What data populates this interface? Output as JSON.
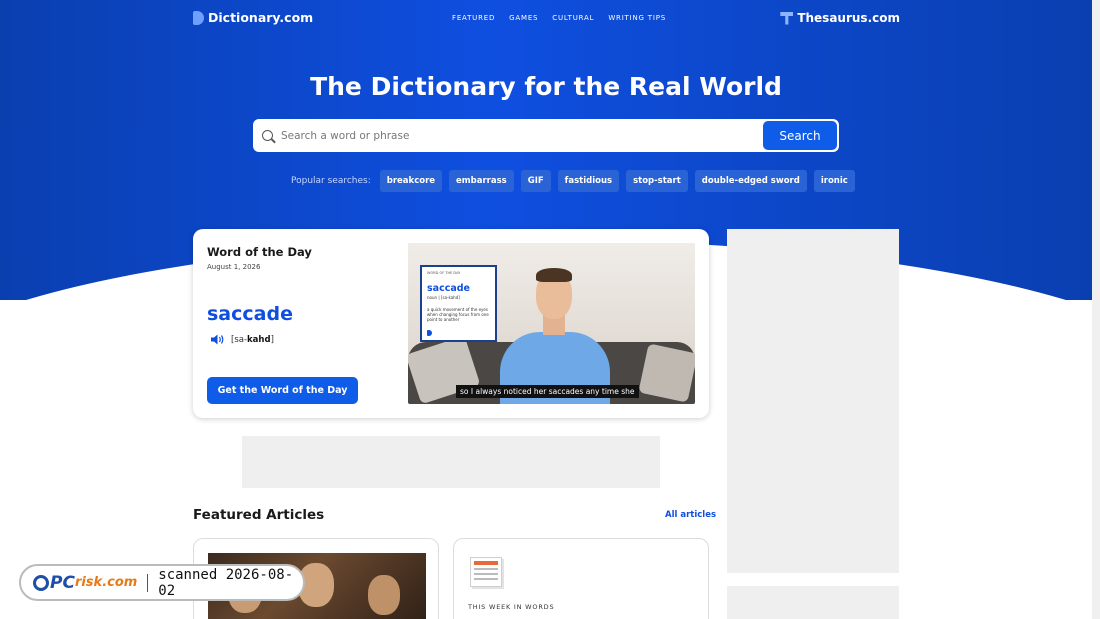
{
  "header": {
    "logo_text": "Dictionary.com",
    "nav": [
      "FEATURED",
      "GAMES",
      "CULTURAL",
      "WRITING TIPS"
    ],
    "thesaurus_text": "Thesaurus.com"
  },
  "hero": {
    "title": "The Dictionary for the Real World",
    "search_placeholder": "Search a word or phrase",
    "search_button": "Search",
    "popular_label": "Popular searches:",
    "popular": [
      "breakcore",
      "embarrass",
      "GIF",
      "fastidious",
      "stop-start",
      "double-edged sword",
      "ironic"
    ]
  },
  "wotd": {
    "title": "Word of the Day",
    "date": "August 1, 2026",
    "word": "saccade",
    "pron_open": "[sa-",
    "pron_bold": "kahd",
    "pron_close": "]",
    "button": "Get the Word of the Day",
    "video": {
      "card_top": "WORD OF THE DAY",
      "card_word": "saccade",
      "card_pron": "noun | [sa-kahd]",
      "card_def": "a quick movement of the eyes when changing focus from one point to another",
      "caption": "so I always noticed her saccades any time she"
    }
  },
  "featured": {
    "title": "Featured Articles",
    "all_link": "All articles",
    "card2_label": "THIS WEEK IN WORDS"
  },
  "watermark": {
    "brand_pc": "PC",
    "brand_risk": "risk.com",
    "scanned": "scanned 2026-08-02"
  },
  "colors": {
    "brand_blue": "#0f4fe0",
    "button_blue": "#0f5ce8",
    "chip_blue": "#2a63d6"
  }
}
